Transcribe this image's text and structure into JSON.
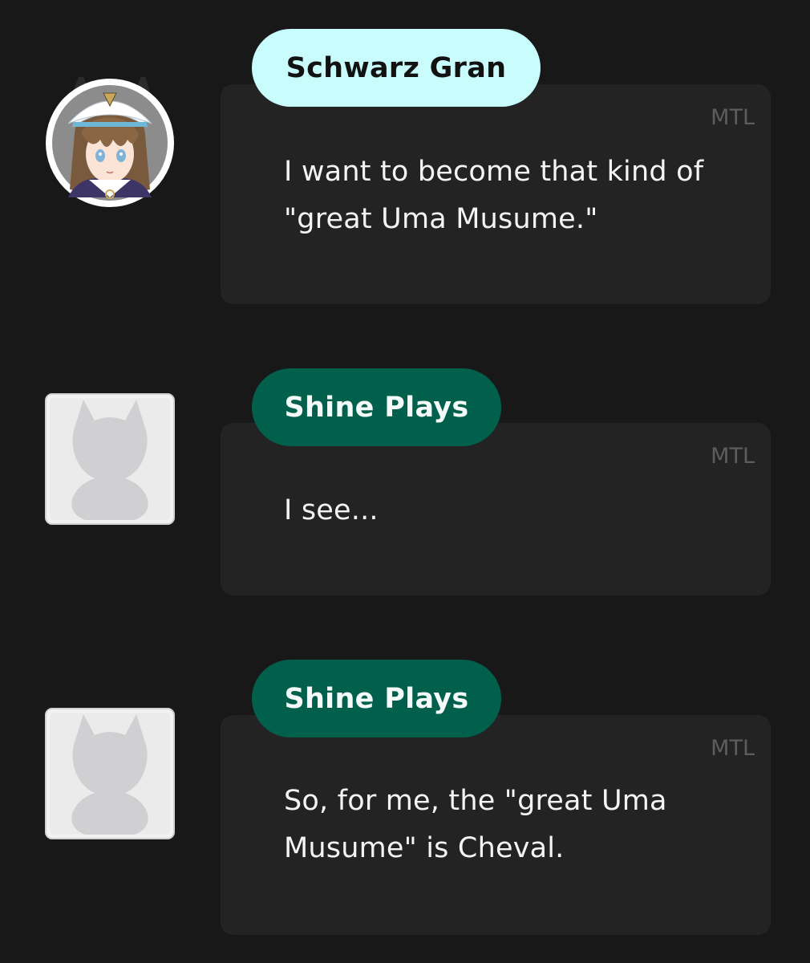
{
  "messages": [
    {
      "speaker": "Schwarz Gran",
      "badge": "MTL",
      "text": "I want to become that kind of \"great Uma Musume.\"",
      "avatar": "character-portrait",
      "name_tag_color": "#c8fcfd"
    },
    {
      "speaker": "Shine Plays",
      "badge": "MTL",
      "text": "I see...",
      "avatar": "silhouette-placeholder-icon",
      "name_tag_color": "#00604c"
    },
    {
      "speaker": "Shine Plays",
      "badge": "MTL",
      "text": "So, for me, the \"great Uma Musume\" is Cheval.",
      "avatar": "silhouette-placeholder-icon",
      "name_tag_color": "#00604c"
    }
  ],
  "colors": {
    "background": "#181818",
    "bubble": "#232323",
    "badge_text": "#5d5d5d",
    "message_text": "#f4f4f4"
  }
}
